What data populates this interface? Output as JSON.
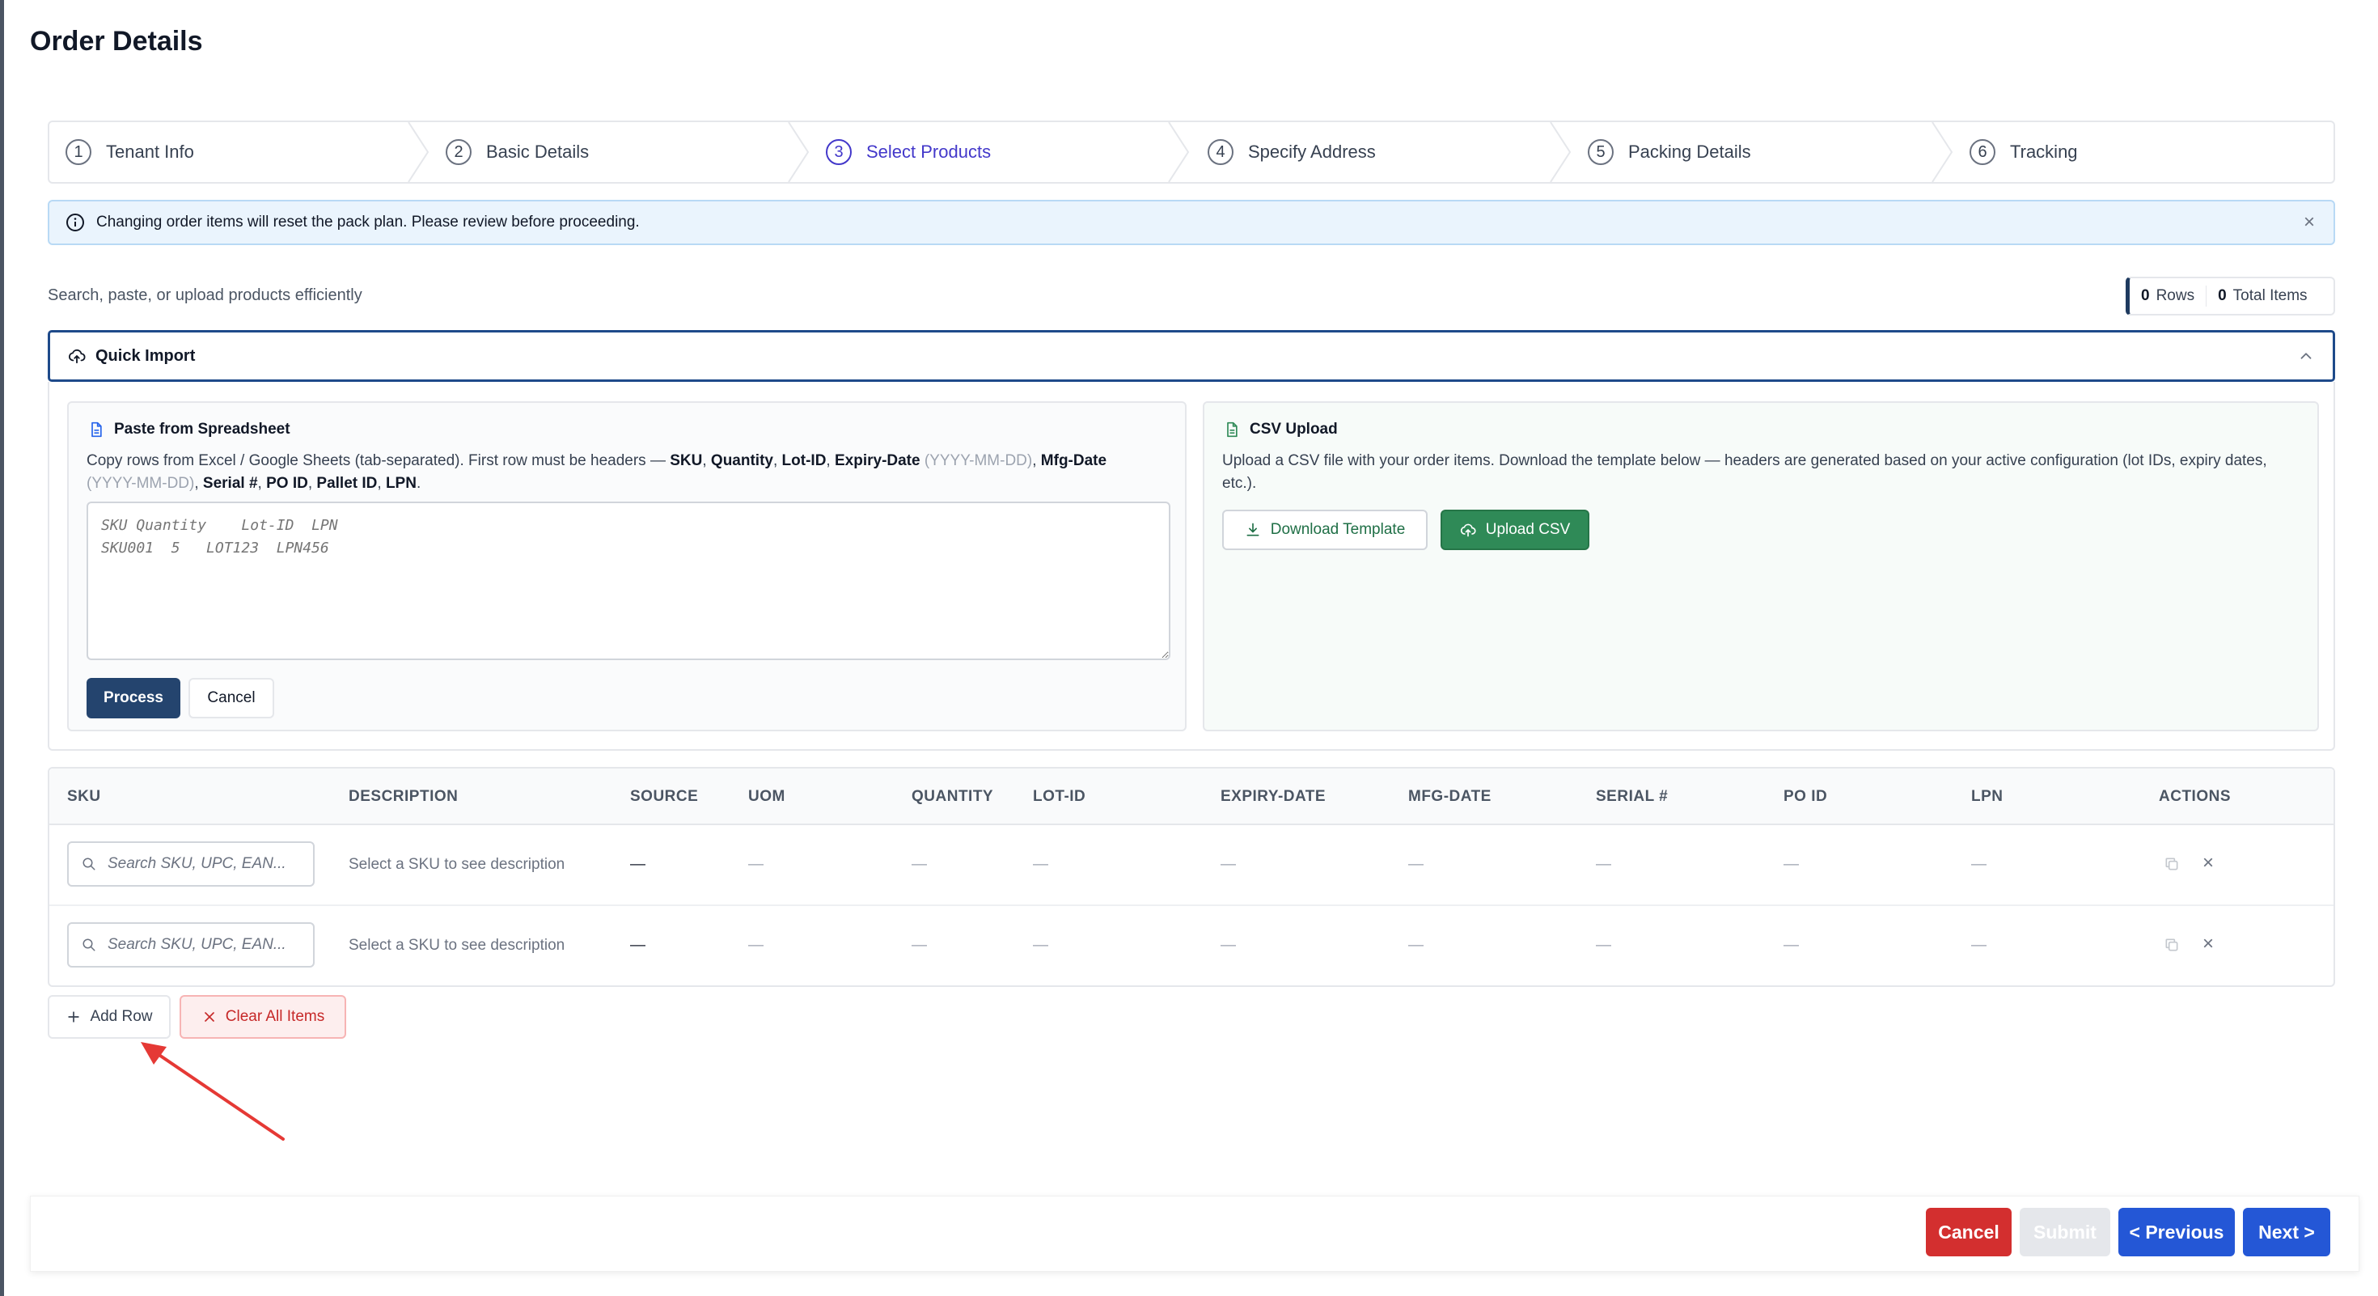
{
  "page": {
    "title": "Order Details"
  },
  "stepper": {
    "steps": [
      {
        "num": "1",
        "label": "Tenant Info"
      },
      {
        "num": "2",
        "label": "Basic Details"
      },
      {
        "num": "3",
        "label": "Select Products"
      },
      {
        "num": "4",
        "label": "Specify Address"
      },
      {
        "num": "5",
        "label": "Packing Details"
      },
      {
        "num": "6",
        "label": "Tracking"
      }
    ],
    "active_step": "3"
  },
  "alert": {
    "text": "Changing order items will reset the pack plan. Please review before proceeding.",
    "close": "×"
  },
  "subtitle": "Search, paste, or upload products efficiently",
  "counts": {
    "rows_value": "0",
    "rows_label": "Rows",
    "items_value": "0",
    "items_label": "Total Items"
  },
  "quick_import": {
    "title": "Quick Import",
    "paste": {
      "title": "Paste from Spreadsheet",
      "desc_1": "Copy rows from Excel / Google Sheets (tab-separated). First row must be headers — ",
      "h_sku": "SKU",
      "comma": ", ",
      "h_qty": "Quantity",
      "h_lot": "Lot-ID",
      "h_exp": "Expiry-Date",
      "fmt": " (YYYY-MM-DD)",
      "h_mfg": "Mfg-Date",
      "fmt2": "(YYYY-MM-DD)",
      "h_serial": "Serial #",
      "h_po": "PO ID",
      "h_pallet": "Pallet ID",
      "h_lpn": "LPN",
      "period": ".",
      "placeholder": "SKU Quantity    Lot-ID  LPN\nSKU001  5   LOT123  LPN456",
      "process_label": "Process",
      "cancel_label": "Cancel"
    },
    "csv": {
      "title": "CSV Upload",
      "desc": "Upload a CSV file with your order items. Download the template below — headers are generated based on your active configuration (lot IDs, expiry dates, etc.).",
      "download_label": "Download Template",
      "upload_label": "Upload CSV"
    }
  },
  "table": {
    "columns": [
      "SKU",
      "DESCRIPTION",
      "SOURCE",
      "UOM",
      "QUANTITY",
      "LOT-ID",
      "EXPIRY-DATE",
      "MFG-DATE",
      "SERIAL #",
      "PO ID",
      "LPN",
      "ACTIONS"
    ],
    "sku_placeholder": "Search SKU, UPC, EAN...",
    "desc_placeholder": "Select a SKU to see description",
    "dash": "—",
    "remove": "×"
  },
  "actions": {
    "add_row": "Add Row",
    "clear_all": "Clear All Items"
  },
  "footer": {
    "cancel": "Cancel",
    "submit": "Submit",
    "previous": "< Previous",
    "next": "Next >"
  },
  "colors": {
    "primary": "#2457d6",
    "danger": "#d32f2f",
    "success": "#2f8a57",
    "navy": "#24446e",
    "annotation_arrow": "#e53935"
  }
}
